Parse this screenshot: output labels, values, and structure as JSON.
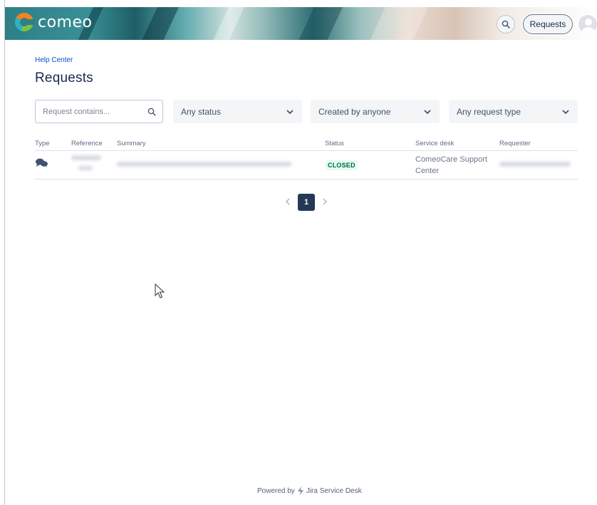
{
  "header": {
    "logo_text": "comeo",
    "search_icon": "search-icon",
    "requests_label": "Requests",
    "avatar_icon": "user-avatar-icon"
  },
  "breadcrumb": "Help Center",
  "page_title": "Requests",
  "filters": {
    "search_placeholder": "Request contains...",
    "status": "Any status",
    "created_by": "Created by anyone",
    "request_type": "Any request type"
  },
  "table": {
    "columns": [
      "Type",
      "Reference",
      "Summary",
      "Status",
      "Service desk",
      "Requester"
    ],
    "rows": [
      {
        "type_icon": "chat-bubbles-icon",
        "reference": "",
        "summary": "",
        "status": "CLOSED",
        "service_desk": "ComeoCare Support Center",
        "requester": ""
      }
    ]
  },
  "pagination": {
    "current_page": "1"
  },
  "footer": {
    "powered_by": "Powered by",
    "product": "Jira Service Desk"
  },
  "colors": {
    "brand_teal": "#2e7f86",
    "link_blue": "#0052cc",
    "closed_green_bg": "#e3fcef",
    "closed_green_text": "#006644",
    "pager_active": "#253858"
  }
}
